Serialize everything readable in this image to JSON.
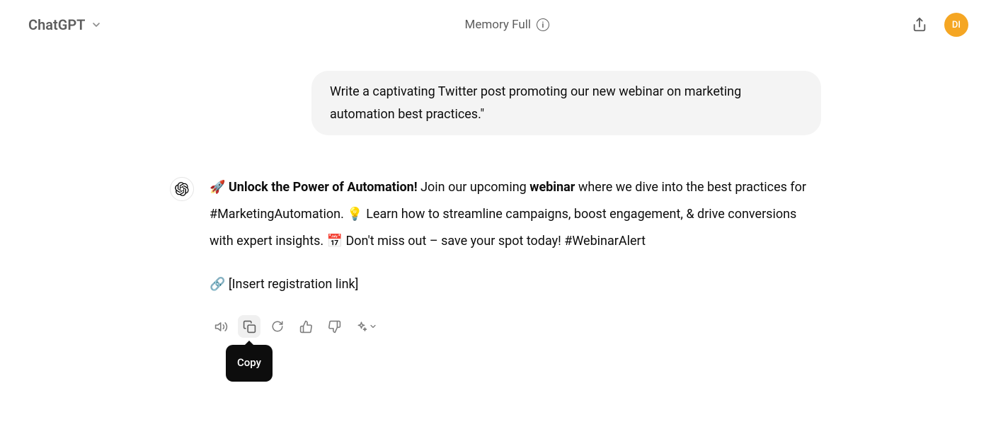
{
  "header": {
    "app_title": "ChatGPT",
    "memory_status": "Memory Full",
    "avatar_initials": "DI"
  },
  "conversation": {
    "user_message": "Write a captivating Twitter post promoting our new webinar on marketing automation best practices.\"",
    "assistant_message": {
      "rocket_emoji": "🚀",
      "bold_lead": "Unlock the Power of Automation!",
      "part1": " Join our upcoming ",
      "bold_webinar": "webinar",
      "part2": " where we dive into the best practices for #MarketingAutomation. ",
      "bulb_emoji": "💡",
      "part3": " Learn how to streamline campaigns, boost engagement, & drive conversions with expert insights. ",
      "calendar_emoji": "📅",
      "part4": " Don't miss out – save your spot today! #WebinarAlert",
      "link_emoji": "🔗",
      "link_text": " [Insert registration link]"
    }
  },
  "tooltip": {
    "copy_label": "Copy"
  }
}
